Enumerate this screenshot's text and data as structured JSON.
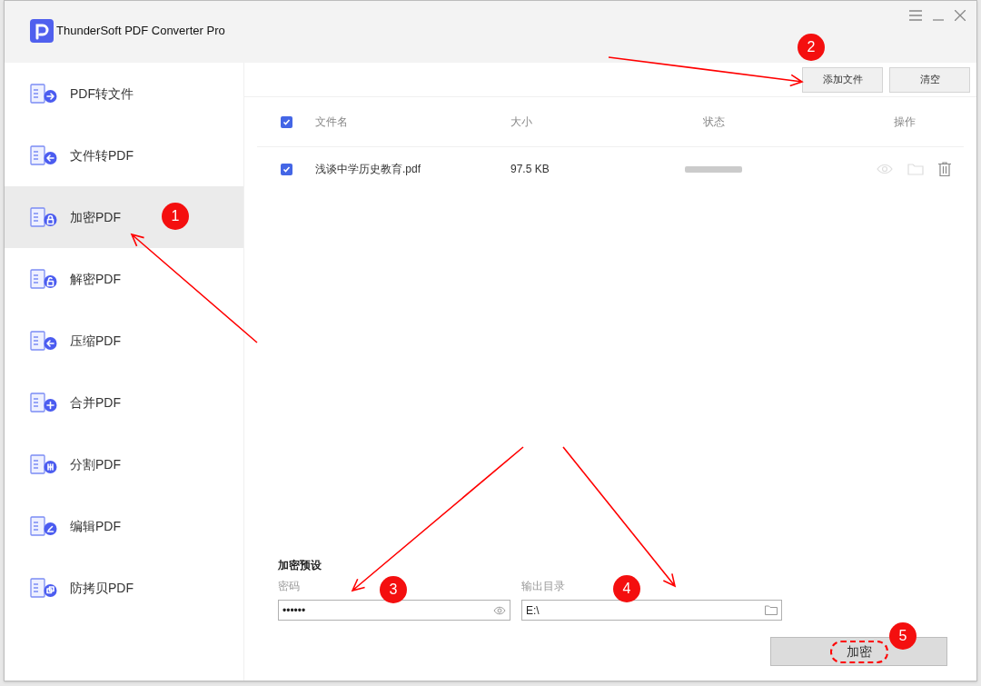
{
  "window": {
    "title": "ThunderSoft PDF Converter Pro"
  },
  "sidebar": {
    "items": [
      {
        "label": "PDF转文件",
        "selected": false
      },
      {
        "label": "文件转PDF",
        "selected": false
      },
      {
        "label": "加密PDF",
        "selected": true
      },
      {
        "label": "解密PDF",
        "selected": false
      },
      {
        "label": "压缩PDF",
        "selected": false
      },
      {
        "label": "合并PDF",
        "selected": false
      },
      {
        "label": "分割PDF",
        "selected": false
      },
      {
        "label": "编辑PDF",
        "selected": false
      },
      {
        "label": "防拷贝PDF",
        "selected": false
      }
    ]
  },
  "toolbar": {
    "buttons": [
      "添加文件",
      "清空"
    ]
  },
  "table": {
    "select_all_checked": true,
    "columns": [
      "文件名",
      "大小",
      "状态",
      "操作"
    ],
    "rows": [
      {
        "checked": true,
        "name": "浅谈中学历史教育.pdf",
        "size": "97.5 KB"
      }
    ]
  },
  "settings": {
    "title": "加密预设",
    "password": {
      "label": "密码",
      "value": "••••••"
    },
    "output": {
      "label": "输出目录",
      "value": "E:\\"
    }
  },
  "action_button": "加密",
  "annotations": [
    {
      "label": "1"
    },
    {
      "label": "2"
    },
    {
      "label": "3"
    },
    {
      "label": "4"
    },
    {
      "label": "5"
    }
  ]
}
